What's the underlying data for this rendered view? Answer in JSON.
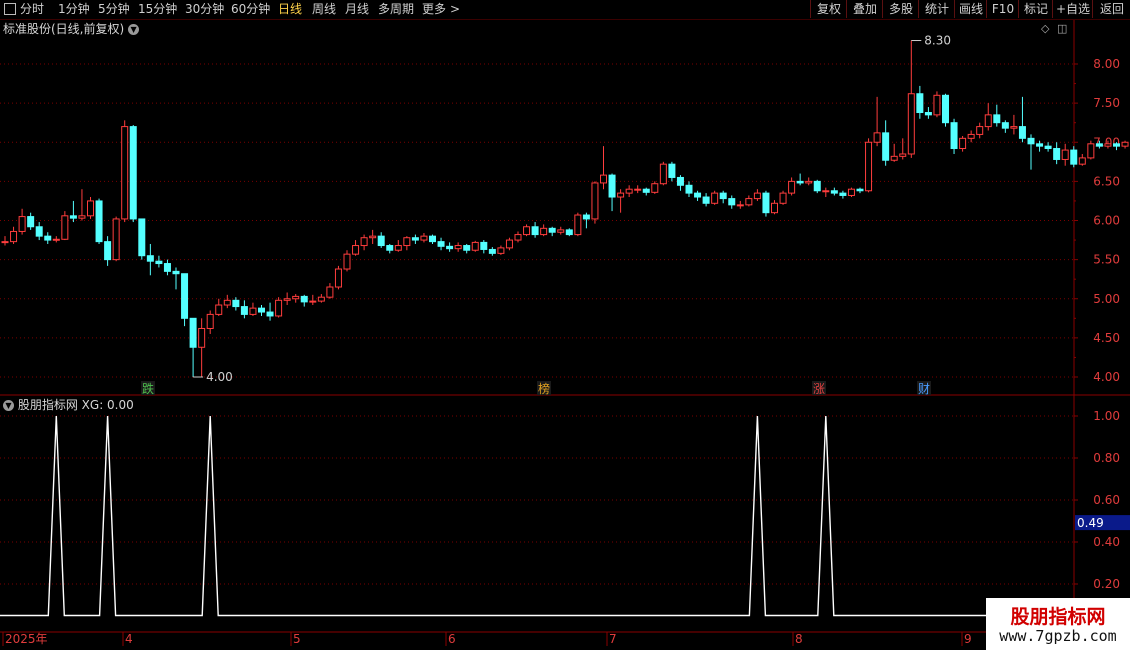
{
  "toolbar": {
    "periods": [
      "分时",
      "1分钟",
      "5分钟",
      "15分钟",
      "30分钟",
      "60分钟",
      "日线",
      "周线",
      "月线",
      "多周期",
      "更多"
    ],
    "active_period": "日线",
    "more_arrow": ">",
    "right_buttons": [
      "复权",
      "叠加",
      "多股",
      "统计",
      "画线",
      "F10",
      "标记",
      "+自选",
      "返回"
    ]
  },
  "main_panel": {
    "title": "标准股份(日线,前复权)",
    "high_label": "8.30",
    "low_label": "4.00",
    "y_axis_ticks": [
      "8.00",
      "7.50",
      "7.00",
      "6.50",
      "6.00",
      "5.50",
      "5.00",
      "4.50",
      "4.00"
    ],
    "event_markers": [
      {
        "text": "跌",
        "color": "#4ec04e"
      },
      {
        "text": "榜",
        "color": "#e0a020"
      },
      {
        "text": "涨",
        "color": "#e04040"
      },
      {
        "text": "财",
        "color": "#4a9cff"
      }
    ]
  },
  "indicator_panel": {
    "title": "股朋指标网",
    "readout": "XG: 0.00",
    "y_axis_ticks": [
      "1.00",
      "0.80",
      "0.60",
      "0.40",
      "0.20"
    ],
    "cursor_value": "0.49"
  },
  "time_axis": {
    "labels": [
      "2025年",
      "4",
      "5",
      "6",
      "7",
      "8",
      "9"
    ]
  },
  "watermark": {
    "title": "股朋指标网",
    "url": "www.7gpzb.com"
  },
  "colors": {
    "up": "#ff3d3d",
    "down": "#54ffff",
    "grid": "#7a0000",
    "axis_text": "#e03c3c",
    "active": "#ffd24a"
  },
  "chart_data": [
    {
      "type": "candlestick",
      "title": "标准股份(日线,前复权)",
      "ylim": [
        3.8,
        8.5
      ],
      "candles": [
        [
          5.72,
          5.73,
          5.68,
          5.8
        ],
        [
          5.73,
          5.86,
          5.7,
          5.92
        ],
        [
          5.86,
          6.05,
          5.82,
          6.15
        ],
        [
          6.05,
          5.92,
          5.88,
          6.1
        ],
        [
          5.92,
          5.8,
          5.75,
          5.98
        ],
        [
          5.8,
          5.75,
          5.7,
          5.85
        ],
        [
          5.75,
          5.76,
          5.72,
          5.8
        ],
        [
          5.76,
          6.06,
          5.75,
          6.12
        ],
        [
          6.06,
          6.03,
          5.98,
          6.25
        ],
        [
          6.03,
          6.06,
          6.0,
          6.4
        ],
        [
          6.06,
          6.25,
          6.02,
          6.3
        ],
        [
          6.25,
          5.73,
          5.7,
          6.28
        ],
        [
          5.73,
          5.5,
          5.42,
          5.8
        ],
        [
          5.5,
          6.02,
          5.48,
          6.05
        ],
        [
          6.02,
          7.2,
          5.98,
          7.28
        ],
        [
          7.2,
          6.02,
          5.98,
          7.22
        ],
        [
          6.02,
          5.55,
          5.5,
          5.88
        ],
        [
          5.55,
          5.48,
          5.3,
          5.7
        ],
        [
          5.48,
          5.45,
          5.4,
          5.55
        ],
        [
          5.45,
          5.35,
          5.3,
          5.5
        ],
        [
          5.35,
          5.32,
          5.12,
          5.4
        ],
        [
          5.32,
          4.75,
          4.65,
          4.95
        ],
        [
          4.75,
          4.38,
          4.0,
          4.45
        ],
        [
          4.38,
          4.62,
          4.0,
          4.75
        ],
        [
          4.62,
          4.8,
          4.55,
          4.85
        ],
        [
          4.8,
          4.92,
          4.78,
          5.0
        ],
        [
          4.92,
          4.98,
          4.88,
          5.05
        ],
        [
          4.98,
          4.9,
          4.85,
          5.02
        ],
        [
          4.9,
          4.8,
          4.75,
          4.98
        ],
        [
          4.8,
          4.88,
          4.78,
          4.95
        ],
        [
          4.88,
          4.83,
          4.78,
          4.92
        ],
        [
          4.83,
          4.78,
          4.72,
          4.95
        ],
        [
          4.78,
          4.98,
          4.76,
          5.02
        ],
        [
          4.98,
          5.0,
          4.92,
          5.08
        ],
        [
          5.0,
          5.03,
          4.95,
          5.06
        ],
        [
          5.03,
          4.96,
          4.9,
          5.05
        ],
        [
          4.96,
          4.97,
          4.92,
          5.05
        ],
        [
          4.97,
          5.02,
          4.95,
          5.06
        ],
        [
          5.02,
          5.15,
          5.0,
          5.2
        ],
        [
          5.15,
          5.38,
          5.12,
          5.42
        ],
        [
          5.38,
          5.57,
          5.35,
          5.62
        ],
        [
          5.57,
          5.68,
          5.55,
          5.75
        ],
        [
          5.68,
          5.78,
          5.62,
          5.82
        ],
        [
          5.78,
          5.8,
          5.7,
          5.88
        ],
        [
          5.8,
          5.68,
          5.65,
          5.85
        ],
        [
          5.68,
          5.62,
          5.58,
          5.7
        ],
        [
          5.62,
          5.68,
          5.6,
          5.75
        ],
        [
          5.68,
          5.78,
          5.62,
          5.8
        ],
        [
          5.78,
          5.75,
          5.7,
          5.82
        ],
        [
          5.75,
          5.8,
          5.72,
          5.84
        ],
        [
          5.8,
          5.73,
          5.7,
          5.82
        ],
        [
          5.73,
          5.67,
          5.62,
          5.78
        ],
        [
          5.67,
          5.64,
          5.6,
          5.72
        ],
        [
          5.64,
          5.68,
          5.6,
          5.72
        ],
        [
          5.68,
          5.62,
          5.58,
          5.7
        ],
        [
          5.62,
          5.72,
          5.6,
          5.74
        ],
        [
          5.72,
          5.63,
          5.58,
          5.75
        ],
        [
          5.63,
          5.58,
          5.55,
          5.66
        ],
        [
          5.58,
          5.65,
          5.56,
          5.68
        ],
        [
          5.65,
          5.75,
          5.62,
          5.78
        ],
        [
          5.75,
          5.82,
          5.72,
          5.86
        ],
        [
          5.82,
          5.92,
          5.8,
          5.95
        ],
        [
          5.92,
          5.82,
          5.78,
          5.98
        ],
        [
          5.82,
          5.9,
          5.8,
          5.95
        ],
        [
          5.9,
          5.85,
          5.8,
          5.92
        ],
        [
          5.85,
          5.88,
          5.82,
          5.92
        ],
        [
          5.88,
          5.82,
          5.8,
          5.9
        ],
        [
          5.82,
          6.07,
          5.8,
          6.1
        ],
        [
          6.07,
          6.02,
          5.9,
          6.1
        ],
        [
          6.02,
          6.48,
          5.96,
          6.5
        ],
        [
          6.48,
          6.58,
          6.4,
          6.95
        ],
        [
          6.58,
          6.3,
          6.12,
          6.6
        ],
        [
          6.3,
          6.35,
          6.1,
          6.4
        ],
        [
          6.35,
          6.4,
          6.3,
          6.45
        ],
        [
          6.4,
          6.4,
          6.35,
          6.45
        ],
        [
          6.4,
          6.36,
          6.32,
          6.42
        ],
        [
          6.36,
          6.47,
          6.34,
          6.5
        ],
        [
          6.47,
          6.72,
          6.45,
          6.75
        ],
        [
          6.72,
          6.55,
          6.5,
          6.75
        ],
        [
          6.55,
          6.45,
          6.38,
          6.58
        ],
        [
          6.45,
          6.35,
          6.3,
          6.5
        ],
        [
          6.35,
          6.3,
          6.25,
          6.38
        ],
        [
          6.3,
          6.22,
          6.18,
          6.35
        ],
        [
          6.22,
          6.35,
          6.2,
          6.38
        ],
        [
          6.35,
          6.28,
          6.22,
          6.38
        ],
        [
          6.28,
          6.2,
          6.15,
          6.32
        ],
        [
          6.2,
          6.2,
          6.15,
          6.25
        ],
        [
          6.2,
          6.28,
          6.18,
          6.32
        ],
        [
          6.28,
          6.35,
          6.25,
          6.4
        ],
        [
          6.35,
          6.1,
          6.05,
          6.38
        ],
        [
          6.1,
          6.22,
          6.08,
          6.26
        ],
        [
          6.22,
          6.35,
          6.2,
          6.38
        ],
        [
          6.35,
          6.5,
          6.32,
          6.55
        ],
        [
          6.5,
          6.48,
          6.45,
          6.6
        ],
        [
          6.48,
          6.5,
          6.45,
          6.55
        ],
        [
          6.5,
          6.38,
          6.35,
          6.52
        ],
        [
          6.38,
          6.38,
          6.3,
          6.42
        ],
        [
          6.38,
          6.35,
          6.32,
          6.42
        ],
        [
          6.35,
          6.32,
          6.28,
          6.38
        ],
        [
          6.32,
          6.4,
          6.3,
          6.42
        ],
        [
          6.4,
          6.38,
          6.35,
          6.42
        ],
        [
          6.38,
          7.0,
          6.36,
          7.05
        ],
        [
          7.0,
          7.12,
          6.95,
          7.58
        ],
        [
          7.12,
          6.77,
          6.7,
          7.28
        ],
        [
          6.77,
          6.82,
          6.75,
          6.98
        ],
        [
          6.82,
          6.85,
          6.78,
          7.05
        ],
        [
          6.85,
          7.62,
          6.8,
          8.3
        ],
        [
          7.62,
          7.38,
          7.3,
          7.72
        ],
        [
          7.38,
          7.35,
          7.3,
          7.45
        ],
        [
          7.35,
          7.6,
          7.32,
          7.65
        ],
        [
          7.6,
          7.25,
          7.2,
          7.62
        ],
        [
          7.25,
          6.92,
          6.85,
          7.3
        ],
        [
          6.92,
          7.05,
          6.88,
          7.08
        ],
        [
          7.05,
          7.1,
          7.0,
          7.15
        ],
        [
          7.1,
          7.2,
          7.05,
          7.25
        ],
        [
          7.2,
          7.35,
          7.15,
          7.5
        ],
        [
          7.35,
          7.25,
          7.2,
          7.48
        ],
        [
          7.25,
          7.18,
          7.12,
          7.28
        ],
        [
          7.18,
          7.2,
          7.1,
          7.35
        ],
        [
          7.2,
          7.05,
          7.0,
          7.58
        ],
        [
          7.05,
          6.98,
          6.65,
          7.1
        ],
        [
          6.98,
          6.95,
          6.88,
          7.02
        ],
        [
          6.95,
          6.92,
          6.88,
          7.0
        ],
        [
          6.92,
          6.78,
          6.72,
          7.0
        ],
        [
          6.78,
          6.9,
          6.7,
          6.98
        ],
        [
          6.9,
          6.72,
          6.68,
          6.95
        ],
        [
          6.72,
          6.8,
          6.7,
          6.85
        ],
        [
          6.8,
          6.98,
          6.78,
          7.02
        ],
        [
          6.98,
          6.95,
          6.92,
          7.02
        ],
        [
          6.95,
          6.98,
          6.92,
          7.02
        ],
        [
          6.98,
          6.95,
          6.9,
          7.0
        ],
        [
          6.95,
          7.0,
          6.92,
          7.02
        ],
        [
          7.0,
          6.9,
          6.85,
          7.05
        ],
        [
          6.9,
          6.85,
          6.8,
          6.95
        ]
      ]
    },
    {
      "type": "line",
      "title": "股朋指标网",
      "series": [
        {
          "name": "XG",
          "signal_indices": [
            6,
            12,
            24,
            88,
            96
          ]
        }
      ],
      "ylim": [
        0,
        1.05
      ]
    }
  ]
}
